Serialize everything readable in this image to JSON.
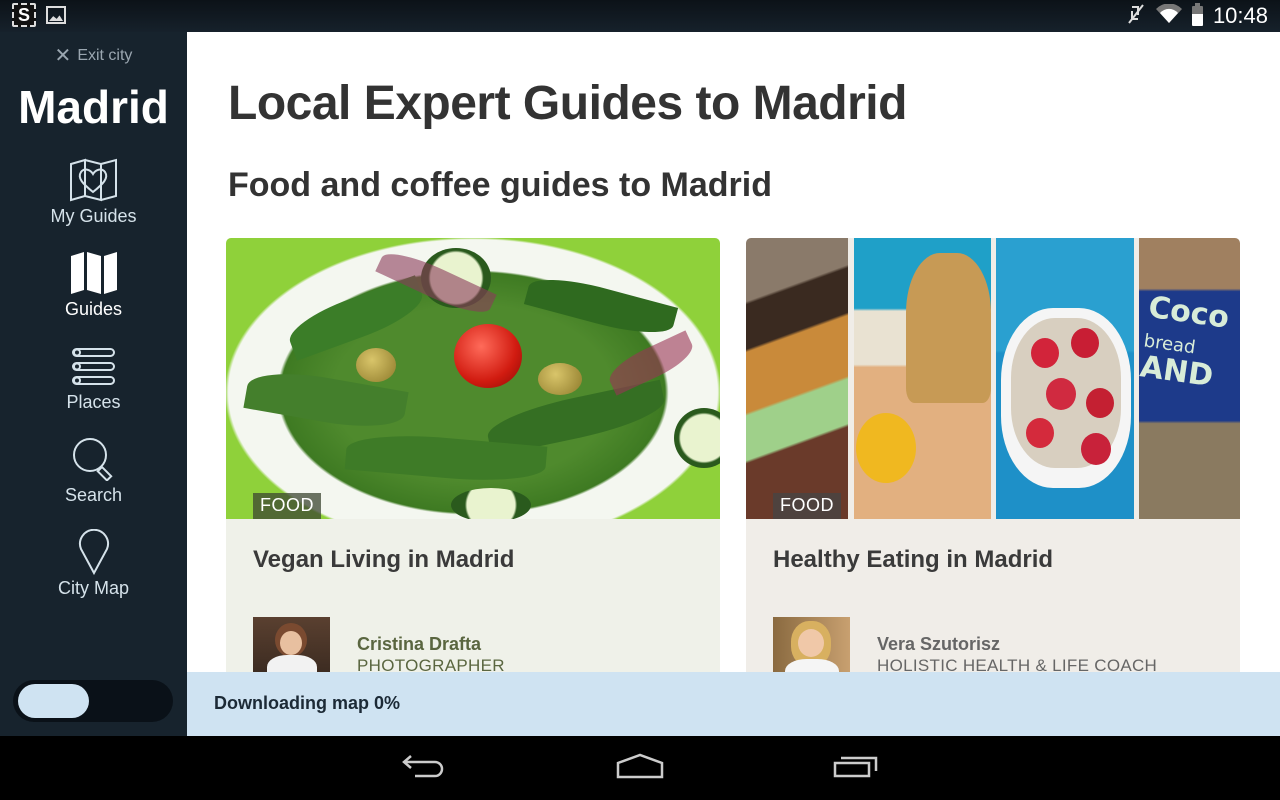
{
  "status_bar": {
    "time": "10:48",
    "left_icons": [
      "app-notification-icon",
      "image-notification-icon"
    ],
    "right_icons": [
      "mute-icon",
      "wifi-icon",
      "battery-icon"
    ]
  },
  "sidebar": {
    "exit_label": "Exit city",
    "city": "Madrid",
    "items": [
      {
        "label": "My Guides",
        "icon": "heart-map-icon",
        "active": false
      },
      {
        "label": "Guides",
        "icon": "folded-map-icon",
        "active": true
      },
      {
        "label": "Places",
        "icon": "list-icon",
        "active": false
      },
      {
        "label": "Search",
        "icon": "search-icon",
        "active": false
      },
      {
        "label": "City Map",
        "icon": "map-pin-icon",
        "active": false
      }
    ],
    "toggle": {
      "on": false
    }
  },
  "main": {
    "title": "Local Expert Guides to Madrid",
    "section_title": "Food and coffee guides to Madrid",
    "cards": [
      {
        "tag": "FOOD",
        "title": "Vegan Living in Madrid",
        "author_name": "Cristina Drafta",
        "author_role": "PHOTOGRAPHER"
      },
      {
        "tag": "FOOD",
        "title": "Healthy Eating in Madrid",
        "author_name": "Vera Szutorisz",
        "author_role": "HOLISTIC HEALTH & LIFE COACH"
      }
    ]
  },
  "download_bar": {
    "text": "Downloading map 0%",
    "progress_percent": 0
  },
  "nav_bar": {
    "buttons": [
      "back",
      "home",
      "recent-apps"
    ]
  },
  "colors": {
    "sidebar_bg": "#17232d",
    "download_bar_bg": "#cfe3f2",
    "title_text": "#333333",
    "author_green": "#5a6640"
  }
}
